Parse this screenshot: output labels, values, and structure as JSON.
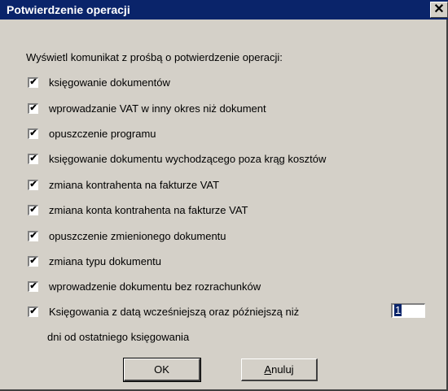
{
  "window": {
    "title": "Potwierdzenie operacji",
    "close_glyph": "✕"
  },
  "prompt": "Wyświetl komunikat z prośbą o potwierdzenie operacji:",
  "options": [
    {
      "label": "księgowanie dokumentów",
      "checked": true
    },
    {
      "label": "wprowadzanie VAT w inny okres niż dokument",
      "checked": true
    },
    {
      "label": "opuszczenie programu",
      "checked": true
    },
    {
      "label": "księgowanie dokumentu wychodzącego poza krąg kosztów",
      "checked": true
    },
    {
      "label": "zmiana kontrahenta na fakturze VAT",
      "checked": true
    },
    {
      "label": "zmiana konta kontrahenta na fakturze VAT",
      "checked": true
    },
    {
      "label": "opuszczenie zmienionego dokumentu",
      "checked": true
    },
    {
      "label": "zmiana typu dokumentu",
      "checked": true
    },
    {
      "label": "wprowadzenie dokumentu bez rozrachunków",
      "checked": true
    },
    {
      "label": "Księgowania z datą wcześniejszą oraz późniejszą niż",
      "checked": true
    }
  ],
  "days": {
    "value": "1",
    "suffix": "dni od ostatniego księgowania"
  },
  "buttons": {
    "ok": "OK",
    "cancel_first": "A",
    "cancel_rest": "nuluj"
  },
  "check_glyph": "✔"
}
